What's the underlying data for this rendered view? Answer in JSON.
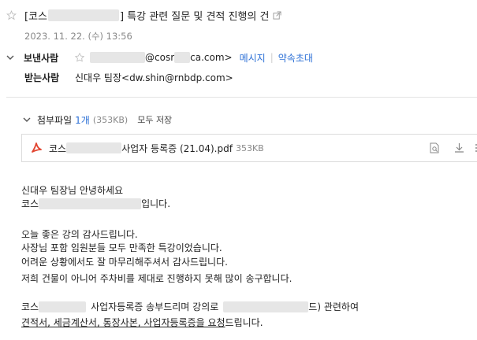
{
  "subject": {
    "prefix": "[코스",
    "text": "] 특강 관련 질문 및 견적 진행의 건"
  },
  "date": "2023. 11. 22. (수) 13:56",
  "sender": {
    "label": "보낸사람",
    "email_suffix": "@cosr",
    "email_domain_end": "ca.com>",
    "action_message": "메시지",
    "action_appointment": "약속초대"
  },
  "recipient": {
    "label": "받는사람",
    "value": "신대우 팀장<dw.shin@rnbdp.com>"
  },
  "attachments": {
    "label": "첨부파일",
    "count": "1개",
    "size": "(353KB)",
    "save_all": "모두 저장",
    "file_prefix": "코스",
    "file_name": "사업자 등록증 (21.04).pdf",
    "file_size": "353KB"
  },
  "body": {
    "greeting": "신대우 팀장님 안녕하세요",
    "intro_prefix": "코스",
    "intro_suffix": "입니다.",
    "p2_l1": "오늘 좋은 강의 감사드립니다.",
    "p2_l2": "사장님 포함 임원분들 모두 만족한 특강이었습니다.",
    "p2_l3": "어려운 상황에서도 잘 마무리해주셔서 감사드립니다.",
    "p2_l4": "저희 건물이 아니어 주차비를 제대로 진행하지 못해 많이 송구합니다.",
    "p3_l1_prefix": "코스",
    "p3_l1_mid": "사업자등록증 송부드리며 강의로",
    "p3_l1_suffix": "드) 관련하여",
    "p3_l2_link": "견적서, 세금계산서, 통장사본, 사업자등록증을 요청",
    "p3_l2_rest": "드립니다."
  },
  "colors": {
    "link": "#2b6fd6",
    "pdf_red": "#e2442f",
    "star": "#bdbdbd"
  }
}
